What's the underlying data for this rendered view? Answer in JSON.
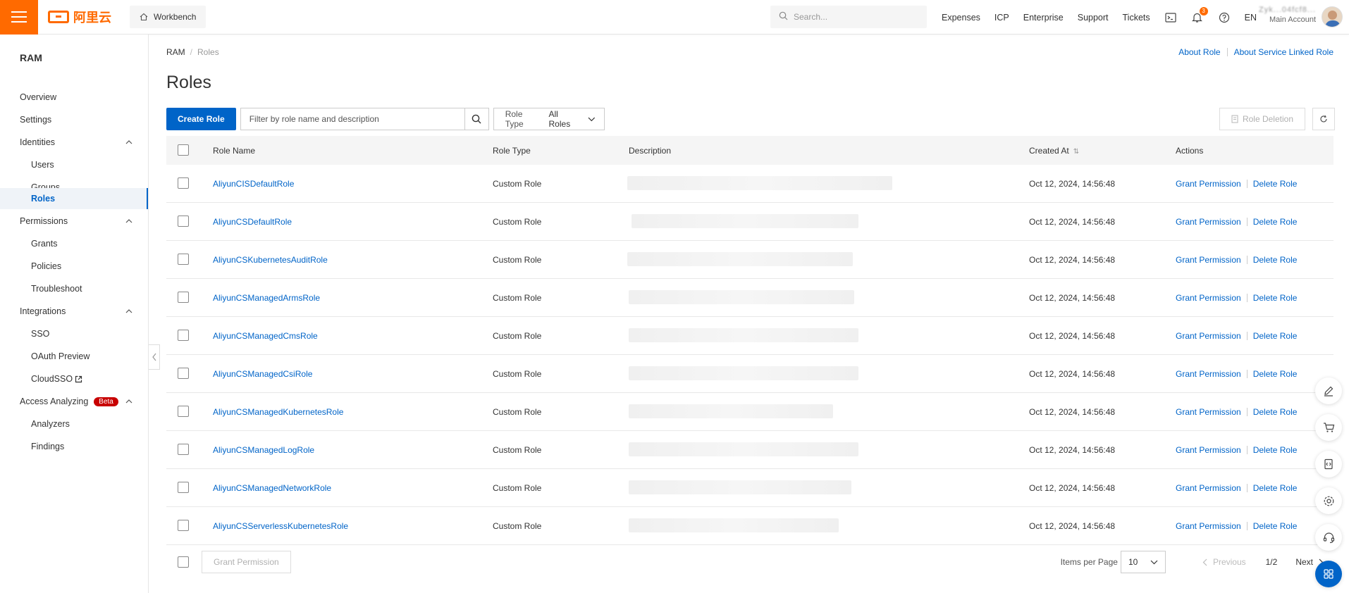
{
  "topbar": {
    "brand": "阿里云",
    "workbench": "Workbench",
    "search_placeholder": "Search...",
    "nav": [
      "Expenses",
      "ICP",
      "Enterprise",
      "Support",
      "Tickets"
    ],
    "notifications_count": "3",
    "language": "EN",
    "account_name": "Zyk...04fcf8...",
    "account_type": "Main Account"
  },
  "sidebar": {
    "title": "RAM",
    "items": [
      {
        "label": "Overview"
      },
      {
        "label": "Settings"
      },
      {
        "label": "Identities"
      },
      {
        "label": "Users"
      },
      {
        "label": "Groups"
      },
      {
        "label": "Roles"
      },
      {
        "label": "Permissions"
      },
      {
        "label": "Grants"
      },
      {
        "label": "Policies"
      },
      {
        "label": "Troubleshoot"
      },
      {
        "label": "Integrations"
      },
      {
        "label": "SSO"
      },
      {
        "label": "OAuth Preview"
      },
      {
        "label": "CloudSSO"
      },
      {
        "label": "Access Analyzing"
      },
      {
        "label": "Analyzers"
      },
      {
        "label": "Findings"
      }
    ],
    "beta_badge": "Beta"
  },
  "breadcrumb": {
    "root": "RAM",
    "current": "Roles"
  },
  "links": {
    "about_role": "About Role",
    "about_slr": "About Service Linked Role"
  },
  "page_title": "Roles",
  "toolbar": {
    "create_role": "Create Role",
    "filter_placeholder": "Filter by role name and description",
    "role_type_label": "Role Type",
    "role_type_value": "All Roles",
    "role_deletion": "Role Deletion"
  },
  "table": {
    "headers": {
      "name": "Role Name",
      "type": "Role Type",
      "description": "Description",
      "created": "Created At",
      "actions": "Actions"
    },
    "action_grant": "Grant Permission",
    "action_delete": "Delete Role",
    "rows": [
      {
        "name": "AliyunCISDefaultRole",
        "type": "Custom Role",
        "created": "Oct 12, 2024, 14:56:48"
      },
      {
        "name": "AliyunCSDefaultRole",
        "type": "Custom Role",
        "created": "Oct 12, 2024, 14:56:48"
      },
      {
        "name": "AliyunCSKubernetesAuditRole",
        "type": "Custom Role",
        "created": "Oct 12, 2024, 14:56:48"
      },
      {
        "name": "AliyunCSManagedArmsRole",
        "type": "Custom Role",
        "created": "Oct 12, 2024, 14:56:48"
      },
      {
        "name": "AliyunCSManagedCmsRole",
        "type": "Custom Role",
        "created": "Oct 12, 2024, 14:56:48"
      },
      {
        "name": "AliyunCSManagedCsiRole",
        "type": "Custom Role",
        "created": "Oct 12, 2024, 14:56:48"
      },
      {
        "name": "AliyunCSManagedKubernetesRole",
        "type": "Custom Role",
        "created": "Oct 12, 2024, 14:56:48"
      },
      {
        "name": "AliyunCSManagedLogRole",
        "type": "Custom Role",
        "created": "Oct 12, 2024, 14:56:48"
      },
      {
        "name": "AliyunCSManagedNetworkRole",
        "type": "Custom Role",
        "created": "Oct 12, 2024, 14:56:48"
      },
      {
        "name": "AliyunCSServerlessKubernetesRole",
        "type": "Custom Role",
        "created": "Oct 12, 2024, 14:56:48"
      }
    ]
  },
  "footer": {
    "grant_permission": "Grant Permission",
    "items_per_page_label": "Items per Page",
    "items_per_page": "10",
    "previous": "Previous",
    "page_info": "1/2",
    "next": "Next"
  },
  "colors": {
    "accent": "#0064c8",
    "brand": "#ff6a00",
    "badge": "#c80000"
  }
}
